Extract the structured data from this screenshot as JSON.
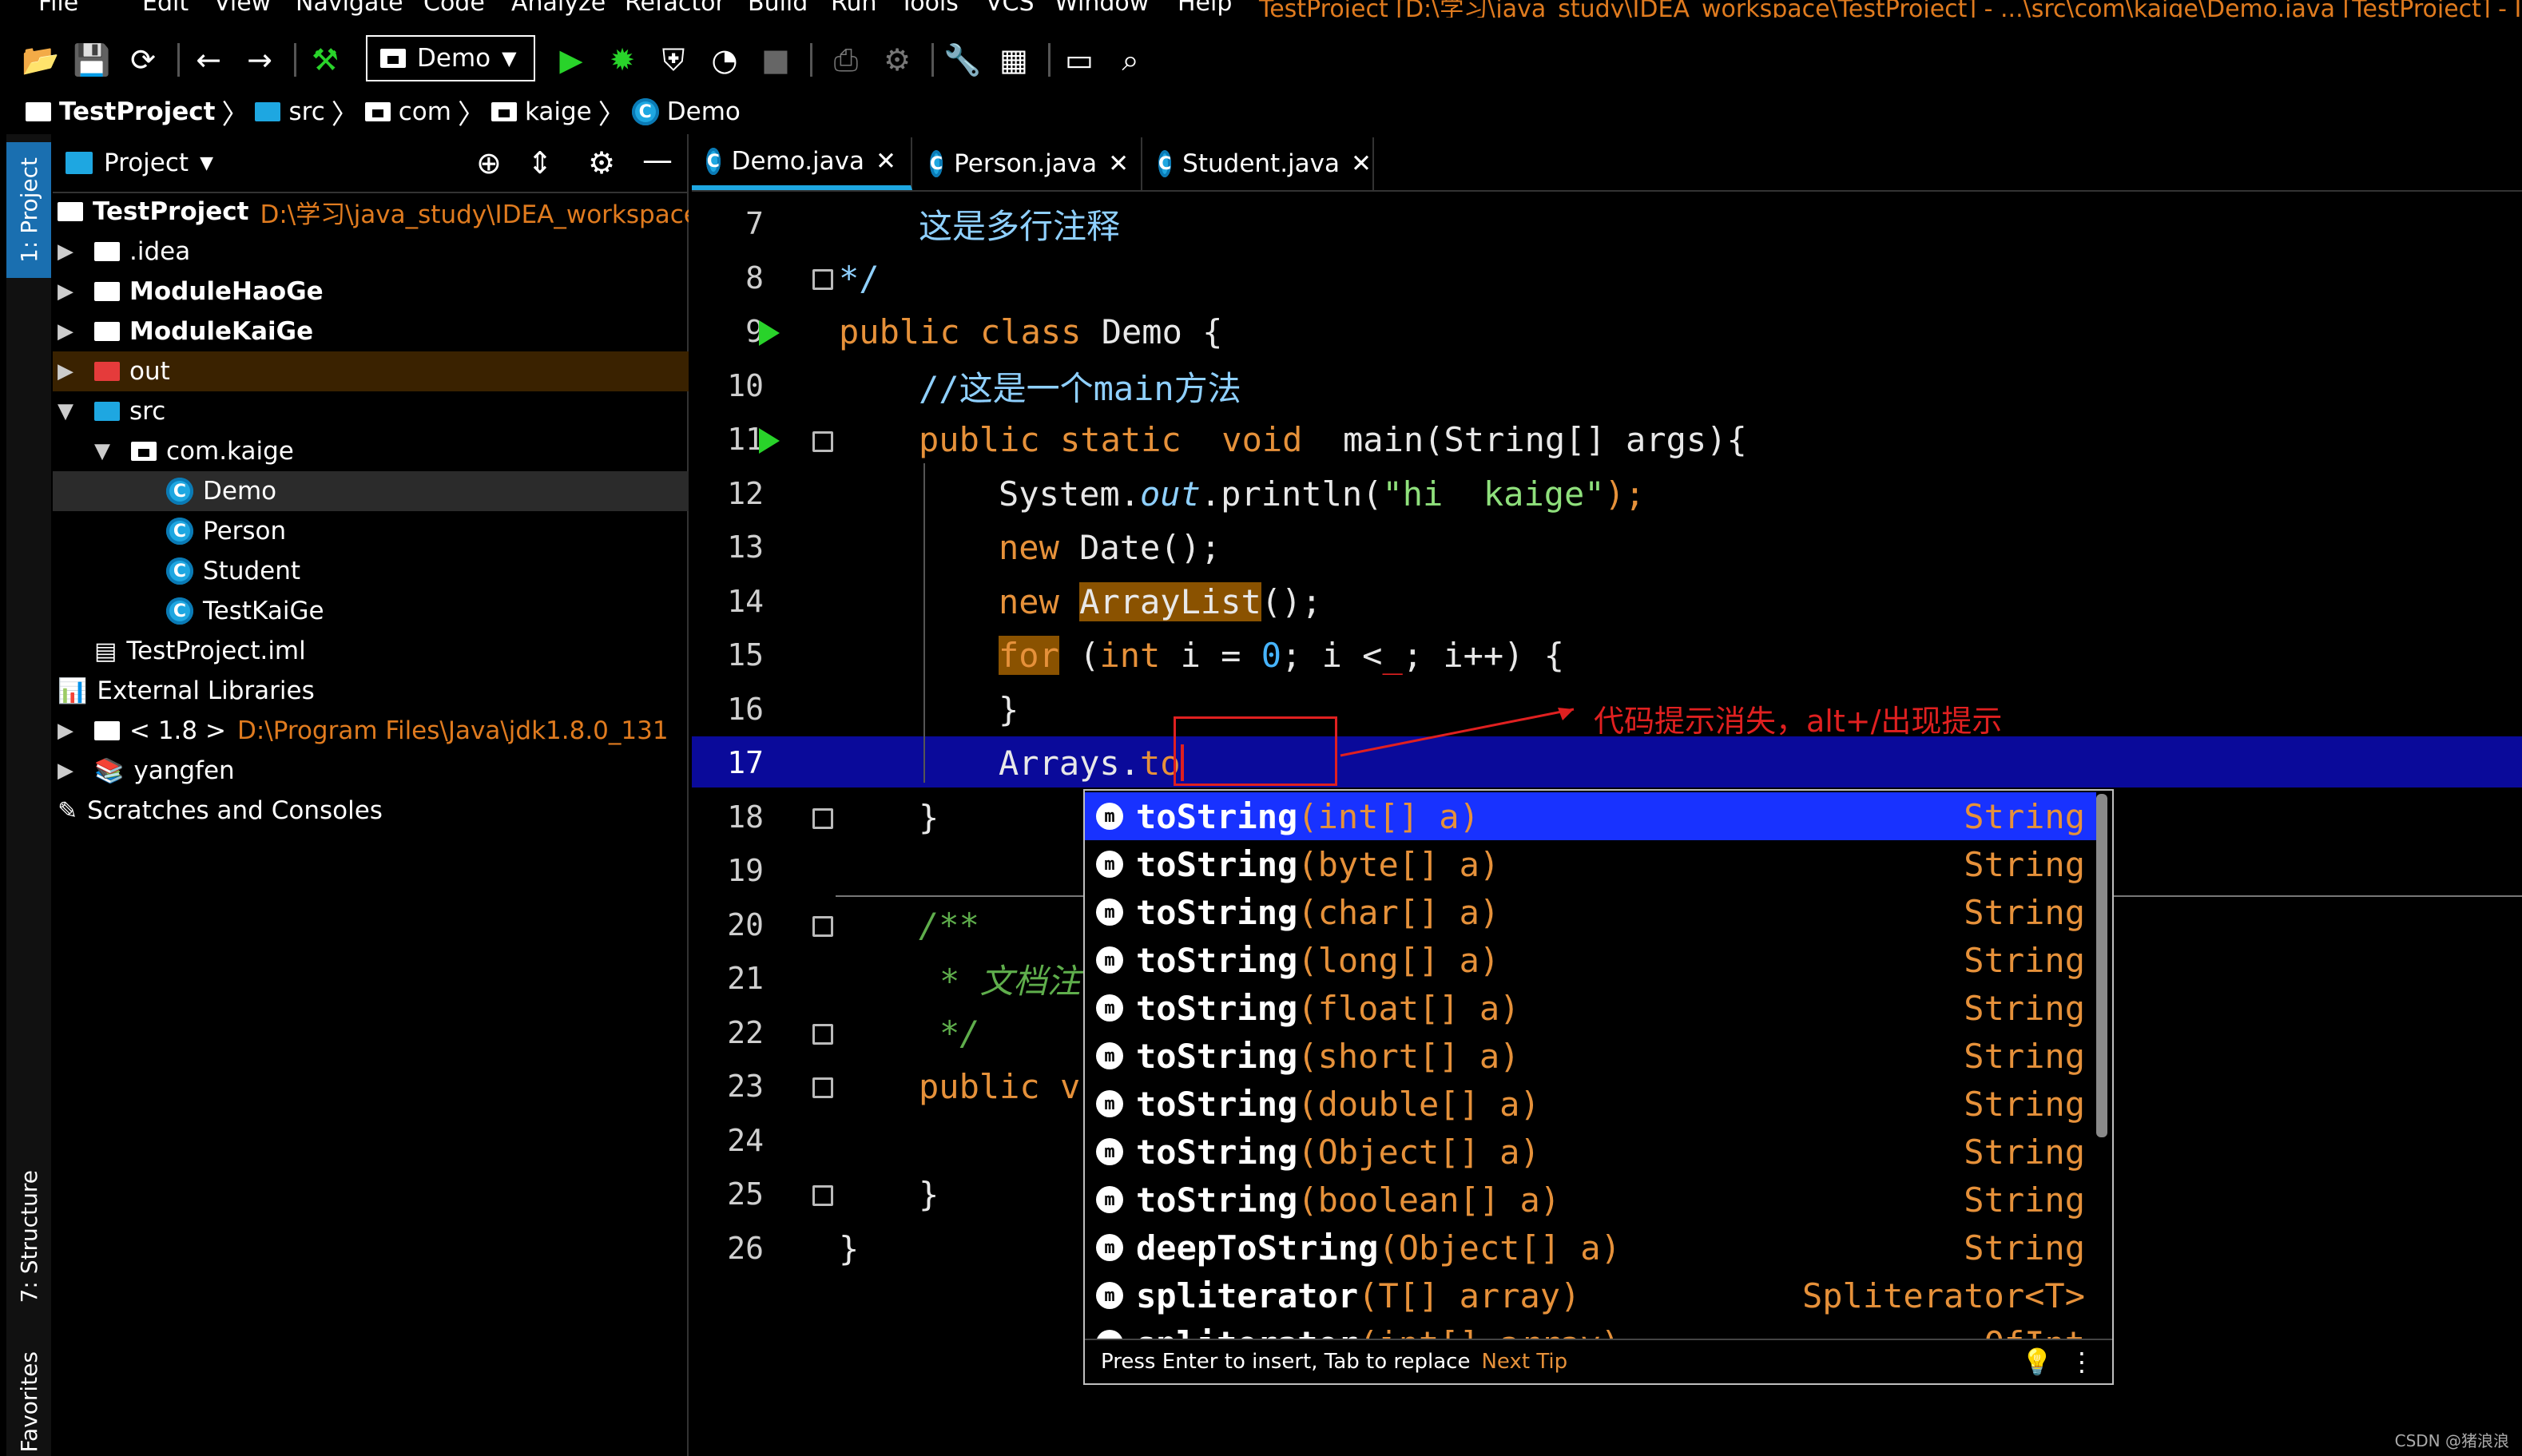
{
  "menu": {
    "items": [
      "File",
      "Edit",
      "View",
      "Navigate",
      "Code",
      "Analyze",
      "Refactor",
      "Build",
      "Run",
      "Tools",
      "VCS",
      "Window",
      "Help"
    ],
    "title": "TestProject [D:\\学习\\java_study\\IDEA_workspace\\TestProject] - ...\\src\\com\\kaige\\Demo.java [TestProject] - IntelliJ IDEA"
  },
  "toolbar": {
    "run_config": "Demo"
  },
  "breadcrumb": {
    "items": [
      "TestProject",
      "src",
      "com",
      "kaige",
      "Demo"
    ]
  },
  "sidebar": {
    "project_tab": "1: Project",
    "structure_tab": "7: Structure",
    "favorites_tab": "Favorites"
  },
  "project_panel": {
    "title": "Project",
    "tree": [
      {
        "label": "TestProject",
        "path": "D:\\学习\\java_study\\IDEA_workspace\\TestProject",
        "bold": true
      },
      {
        "label": ".idea"
      },
      {
        "label": "ModuleHaoGe",
        "bold": true
      },
      {
        "label": "ModuleKaiGe",
        "bold": true
      },
      {
        "label": "out"
      },
      {
        "label": "src"
      },
      {
        "label": "com.kaige"
      },
      {
        "label": "Demo"
      },
      {
        "label": "Person"
      },
      {
        "label": "Student"
      },
      {
        "label": "TestKaiGe"
      },
      {
        "label": "TestProject.iml"
      },
      {
        "label": "External Libraries"
      },
      {
        "label": "< 1.8 >",
        "path": "D:\\Program Files\\Java\\jdk1.8.0_131"
      },
      {
        "label": "yangfen"
      },
      {
        "label": "Scratches and Consoles"
      }
    ]
  },
  "editor": {
    "tabs": [
      "Demo.java",
      "Person.java",
      "Student.java"
    ],
    "line_numbers": [
      "7",
      "8",
      "9",
      "10",
      "11",
      "12",
      "13",
      "14",
      "15",
      "16",
      "17",
      "18",
      "19",
      "20",
      "21",
      "22",
      "23",
      "24",
      "25",
      "26"
    ],
    "code": {
      "l7": "这是多行注释",
      "l8": "*/",
      "l9a": "public class ",
      "l9b": "Demo {",
      "l10": "//这是一个main方法",
      "l11a": "public static  void  ",
      "l11b": "main(String[] args){",
      "l12a": "System.",
      "l12b": "out",
      ".l12c": "",
      "l12d": ".println(",
      "l12e": "\"hi  kaige\"",
      "l12f": ");",
      "l13a": "new ",
      "l13b": "Date();",
      "l14a": "new ",
      "l14b": "ArrayList",
      "l14c": "();",
      "l15a": "for",
      " l15b": "",
      "l15c": " (",
      "l15d": "int",
      " l15e": "",
      "l15f": " i = ",
      "l15g": "0",
      ";l15h": "",
      "l15i": "; i <",
      "l15j": "_",
      "l15k": "; i++) {",
      "l16": "}",
      "l17a": "Arrays.",
      "l17b": "to",
      "l18": "}",
      "l20": "/**",
      "l21": "* 文档注",
      "l22": "*/",
      "l23a": "public v",
      "l25": "}",
      "l26": "}"
    }
  },
  "completion": {
    "items": [
      {
        "name": "toString",
        "params": "(int[] a)",
        "type": "String"
      },
      {
        "name": "toString",
        "params": "(byte[] a)",
        "type": "String"
      },
      {
        "name": "toString",
        "params": "(char[] a)",
        "type": "String"
      },
      {
        "name": "toString",
        "params": "(long[] a)",
        "type": "String"
      },
      {
        "name": "toString",
        "params": "(float[] a)",
        "type": "String"
      },
      {
        "name": "toString",
        "params": "(short[] a)",
        "type": "String"
      },
      {
        "name": "toString",
        "params": "(double[] a)",
        "type": "String"
      },
      {
        "name": "toString",
        "params": "(Object[] a)",
        "type": "String"
      },
      {
        "name": "toString",
        "params": "(boolean[] a)",
        "type": "String"
      },
      {
        "name": "deepToString",
        "params": "(Object[] a)",
        "type": "String"
      },
      {
        "name": "spliterator",
        "params": "(T[] array)",
        "type": "Spliterator<T>"
      },
      {
        "name": "spliterator",
        "params": "(int[] array)",
        "type": "OfInt"
      }
    ],
    "footer": "Press Enter to insert, Tab to replace",
    "next_tip": "Next Tip"
  },
  "annotation": {
    "text": "代码提示消失，alt+/出现提示"
  },
  "watermark": "CSDN @猪浪浪",
  "colors": {
    "accent": "#1ea7e1",
    "selection": "#1832ff",
    "keyword": "#e6913a",
    "annotation": "#e02020"
  }
}
